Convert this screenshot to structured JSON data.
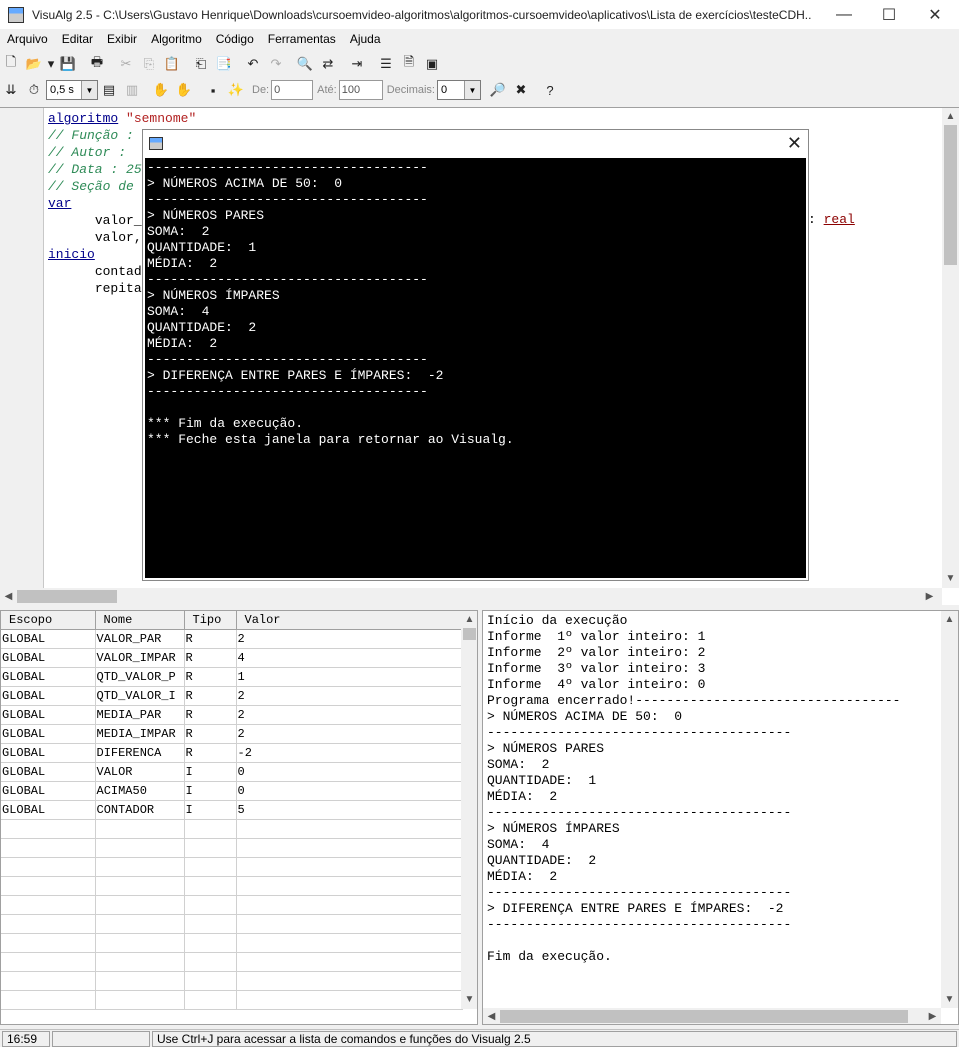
{
  "window": {
    "title": "VisuAlg 2.5 - C:\\Users\\Gustavo Henrique\\Downloads\\cursoemvideo-algoritmos\\algoritmos-cursoemvideo\\aplicativos\\Lista de exercícios\\testeCDH....",
    "minimize": "—",
    "maximize": "☐",
    "close": "✕"
  },
  "menu": [
    "Arquivo",
    "Editar",
    "Exibir",
    "Algoritmo",
    "Código",
    "Ferramentas",
    "Ajuda"
  ],
  "toolbar": {
    "speed": "0,5 s",
    "de_label": "De:",
    "de_value": "0",
    "ate_label": "Até:",
    "ate_value": "100",
    "decimais_label": "Decimais:",
    "decimais_value": "0"
  },
  "editor": {
    "line1_kw": "algoritmo",
    "line1_str": "\"semnome\"",
    "line2": "// Função :",
    "line3": "// Autor :",
    "line4": "// Data : 25",
    "line5": "// Seção de",
    "line6": "var",
    "line7": "valor_",
    "line7_type": "real",
    "line8": "valor,",
    "line9": "inicio",
    "line10": "contad",
    "line11": "repita"
  },
  "console": {
    "lines": [
      "------------------------------------",
      "> NÚMEROS ACIMA DE 50:  0",
      "------------------------------------",
      "> NÚMEROS PARES",
      "SOMA:  2",
      "QUANTIDADE:  1",
      "MÉDIA:  2",
      "------------------------------------",
      "> NÚMEROS ÍMPARES",
      "SOMA:  4",
      "QUANTIDADE:  2",
      "MÉDIA:  2",
      "------------------------------------",
      "> DIFERENÇA ENTRE PARES E ÍMPARES:  -2",
      "------------------------------------",
      "",
      "*** Fim da execução.",
      "*** Feche esta janela para retornar ao Visualg."
    ]
  },
  "variables": {
    "headers": [
      "Escopo",
      "Nome",
      "Tipo",
      "Valor"
    ],
    "rows": [
      [
        "GLOBAL",
        "VALOR_PAR",
        "R",
        "2"
      ],
      [
        "GLOBAL",
        "VALOR_IMPAR",
        "R",
        "4"
      ],
      [
        "GLOBAL",
        "QTD_VALOR_P",
        "R",
        "1"
      ],
      [
        "GLOBAL",
        "QTD_VALOR_I",
        "R",
        "2"
      ],
      [
        "GLOBAL",
        "MEDIA_PAR",
        "R",
        "2"
      ],
      [
        "GLOBAL",
        "MEDIA_IMPAR",
        "R",
        "2"
      ],
      [
        "GLOBAL",
        "DIFERENCA",
        "R",
        "-2"
      ],
      [
        "GLOBAL",
        "VALOR",
        "I",
        "0"
      ],
      [
        "GLOBAL",
        "ACIMA50",
        "I",
        "0"
      ],
      [
        "GLOBAL",
        "CONTADOR",
        "I",
        "5"
      ]
    ]
  },
  "output": {
    "lines": [
      "Início da execução",
      "Informe  1º valor inteiro: 1",
      "Informe  2º valor inteiro: 2",
      "Informe  3º valor inteiro: 3",
      "Informe  4º valor inteiro: 0",
      "Programa encerrado!----------------------------------",
      "> NÚMEROS ACIMA DE 50:  0",
      "---------------------------------------",
      "> NÚMEROS PARES",
      "SOMA:  2",
      "QUANTIDADE:  1",
      "MÉDIA:  2",
      "---------------------------------------",
      "> NÚMEROS ÍMPARES",
      "SOMA:  4",
      "QUANTIDADE:  2",
      "MÉDIA:  2",
      "---------------------------------------",
      "> DIFERENÇA ENTRE PARES E ÍMPARES:  -2",
      "---------------------------------------",
      "",
      "Fim da execução."
    ]
  },
  "status": {
    "time": "16:59",
    "hint": "Use Ctrl+J para acessar a lista de comandos e funções do Visualg 2.5"
  }
}
